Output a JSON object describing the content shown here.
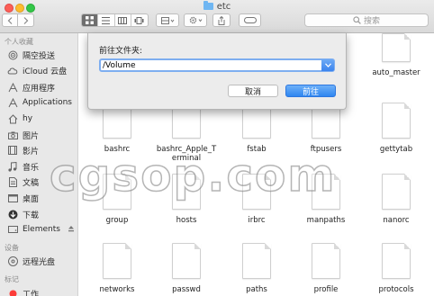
{
  "window": {
    "title": "etc"
  },
  "search": {
    "placeholder": "搜索"
  },
  "sidebar": {
    "favorites_header": "个人收藏",
    "favorites": [
      {
        "label": "隔空投送",
        "icon": "airdrop-icon"
      },
      {
        "label": "iCloud 云盘",
        "icon": "cloud-icon"
      },
      {
        "label": "应用程序",
        "icon": "applications-icon"
      },
      {
        "label": "Applications",
        "icon": "applications-icon"
      },
      {
        "label": "hy",
        "icon": "home-icon"
      },
      {
        "label": "图片",
        "icon": "camera-icon"
      },
      {
        "label": "影片",
        "icon": "film-icon"
      },
      {
        "label": "音乐",
        "icon": "music-icon"
      },
      {
        "label": "文稿",
        "icon": "document-icon"
      },
      {
        "label": "桌面",
        "icon": "desktop-icon"
      },
      {
        "label": "下载",
        "icon": "download-icon"
      },
      {
        "label": "Elements",
        "icon": "drive-icon"
      }
    ],
    "devices_header": "设备",
    "devices": [
      {
        "label": "远程光盘",
        "icon": "disc-icon"
      }
    ],
    "tags_header": "标记",
    "tags": [
      {
        "label": "工作",
        "icon": "tag-red-icon"
      }
    ]
  },
  "files": {
    "row0": [
      "auto_master"
    ],
    "row1": [
      "bashrc",
      "bashrc_Apple_Terminal",
      "fstab",
      "ftpusers",
      "gettytab"
    ],
    "row2": [
      "group",
      "hosts",
      "irbrc",
      "manpaths",
      "nanorc"
    ],
    "row3": [
      "networks",
      "passwd",
      "paths",
      "profile",
      "protocols"
    ]
  },
  "dialog": {
    "label": "前往文件夹:",
    "path_value": "/Volume",
    "cancel_label": "取消",
    "go_label": "前往"
  },
  "watermark": "cgsop.com"
}
